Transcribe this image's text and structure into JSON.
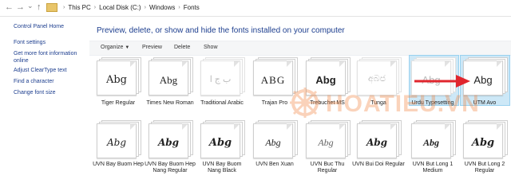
{
  "nav": {
    "back_glyph": "←",
    "forward_glyph": "→",
    "recent_glyph": "⌄",
    "up_glyph": "↑"
  },
  "breadcrumb": [
    "This PC",
    "Local Disk (C:)",
    "Windows",
    "Fonts"
  ],
  "left_pane": {
    "home": "Control Panel Home",
    "links": [
      "Font settings",
      "Get more font information online",
      "Adjust ClearType text",
      "Find a character",
      "Change font size"
    ]
  },
  "header": {
    "title": "Preview, delete, or show and hide the fonts installed on your computer"
  },
  "toolbar": {
    "organize": "Organize",
    "preview": "Preview",
    "delete": "Delete",
    "show": "Show"
  },
  "fonts_row1": [
    {
      "sample": "Abg",
      "name": "Tiger Regular",
      "hidden": false,
      "selected": false
    },
    {
      "sample": "Abg",
      "name": "Times New Roman",
      "hidden": false,
      "selected": false
    },
    {
      "sample": "ﺏ ﺝ ﺍ",
      "name": "Traditional Arabic",
      "hidden": true,
      "selected": false
    },
    {
      "sample": "ABG",
      "name": "Trajan Pro",
      "hidden": false,
      "selected": false
    },
    {
      "sample": "Abg",
      "name": "Trebuchet MS",
      "hidden": false,
      "selected": false
    },
    {
      "sample": "අබජ",
      "name": "Tunga",
      "hidden": true,
      "selected": false
    },
    {
      "sample": "Abg",
      "name": "Urdu Typesetting",
      "hidden": true,
      "selected": true
    },
    {
      "sample": "Abg",
      "name": "UTM Avo",
      "hidden": false,
      "selected": true
    }
  ],
  "fonts_row2": [
    {
      "sample": "Abg",
      "name": "UVN Bay Buom Hep"
    },
    {
      "sample": "Abg",
      "name": "UVN Bay Buom Hep Nang Regular"
    },
    {
      "sample": "Abg",
      "name": "UVN Bay Buom Nang Black"
    },
    {
      "sample": "Abg",
      "name": "UVN Ben Xuan"
    },
    {
      "sample": "Abg",
      "name": "UVN Buc Thu Regular"
    },
    {
      "sample": "Abg",
      "name": "UVN Bui Doi Regular"
    },
    {
      "sample": "Abg",
      "name": "UVN But Long 1 Medium"
    },
    {
      "sample": "Abg",
      "name": "UVN But Long 2 Regular"
    }
  ],
  "watermark": {
    "text": "HOATIEU.VN"
  },
  "colors": {
    "link": "#1e3f8f",
    "selection": "#cde8f7",
    "arrow": "#e0262e",
    "watermark": "#f1803c"
  }
}
